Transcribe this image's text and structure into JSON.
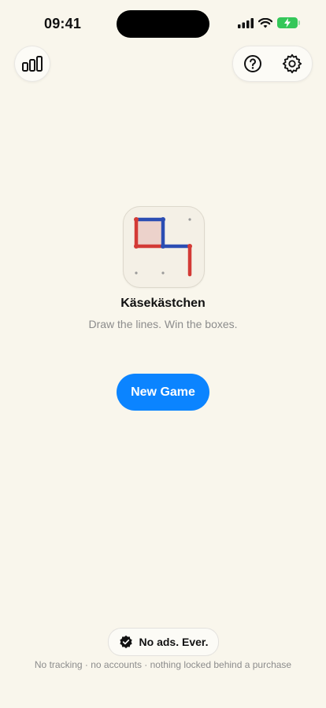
{
  "status_bar": {
    "time": "09:41"
  },
  "app": {
    "title": "Käsekästchen",
    "subtitle": "Draw the lines. Win the boxes."
  },
  "actions": {
    "new_game_label": "New Game"
  },
  "footer": {
    "badge_label": "No ads. Ever.",
    "note": "No tracking · no accounts · nothing locked behind a purchase"
  },
  "icons": {
    "stats": "bar-chart-icon",
    "help": "question-circle-icon",
    "settings": "gear-icon",
    "badge": "verified-check-icon"
  },
  "colors": {
    "background": "#f9f6ec",
    "accent": "#0b84ff",
    "player_blue": "#2b4db3",
    "player_red": "#d33a36",
    "box_fill": "#ecd2cb",
    "battery": "#34c759"
  }
}
